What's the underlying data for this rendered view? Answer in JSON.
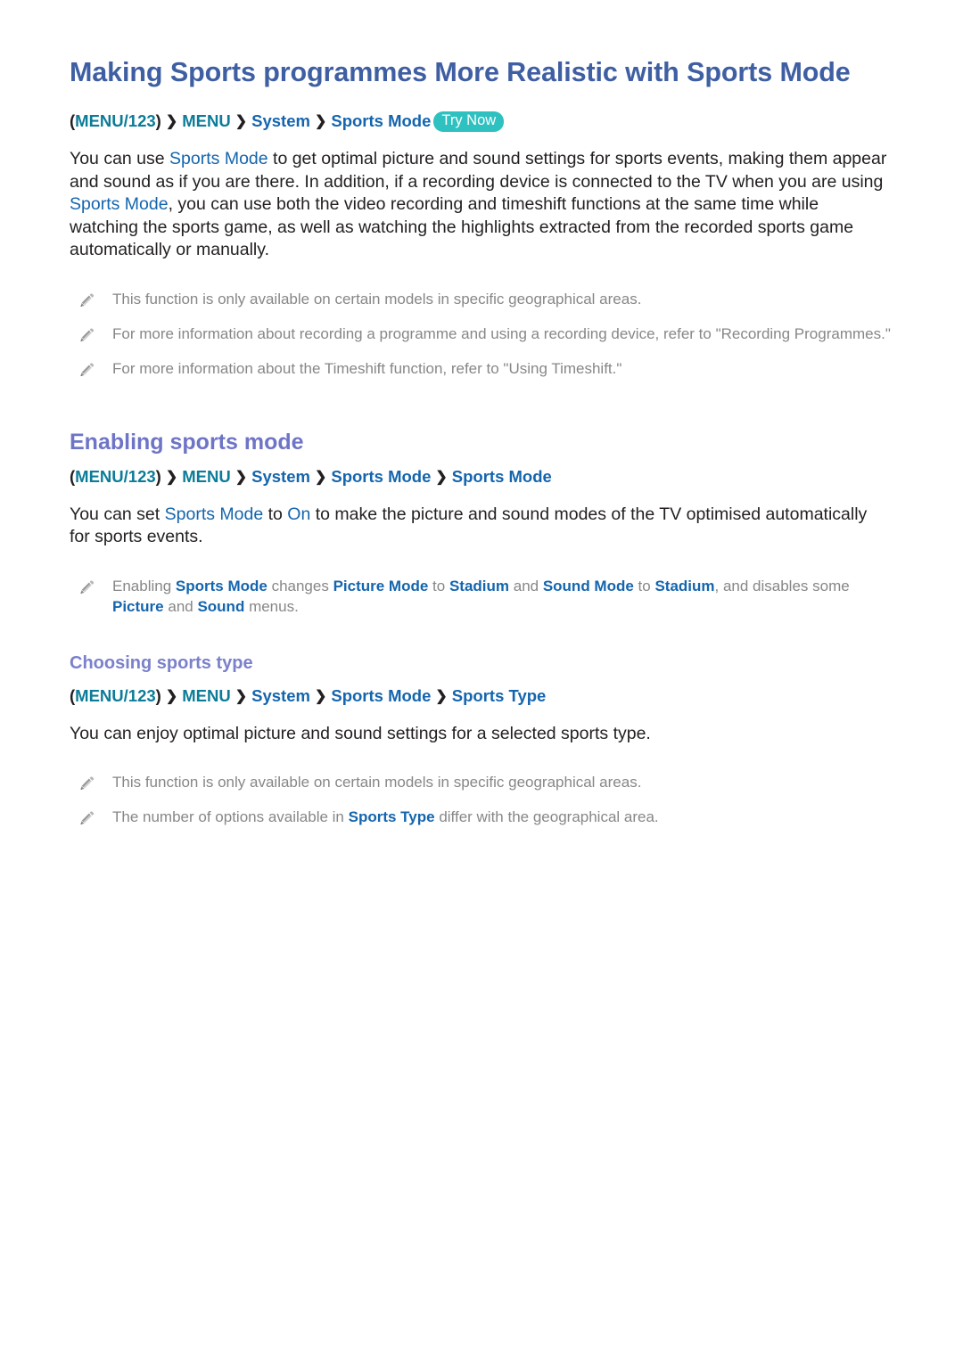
{
  "page": {
    "title": "Making Sports programmes More Realistic with Sports Mode"
  },
  "colors": {
    "title_blue": "#3f5fa3",
    "heading_purple": "#6e74c6",
    "subheading_purple": "#7b81ca",
    "link_blue": "#1465ae",
    "menu_teal": "#0c7c98",
    "badge_teal": "#2ec1bf",
    "note_gray": "#878787",
    "body_black": "#231f20",
    "background": "#ffffff"
  },
  "breadcrumb_main": {
    "open_paren": "(",
    "menu123": "MENU/123",
    "close_paren": ")",
    "separator": "❯",
    "items": [
      "MENU",
      "System",
      "Sports Mode"
    ],
    "badge": "Try Now"
  },
  "intro": {
    "p1_a": "You can use ",
    "p1_link1": "Sports Mode",
    "p1_b": " to get optimal picture and sound settings for sports events, making them appear and sound as if you are there. In addition, if a recording device is connected to the TV when you are using ",
    "p1_link2": "Sports Mode",
    "p1_c": ", you can use both the video recording and timeshift functions at the same time while watching the sports game, as well as watching the highlights extracted from the recorded sports game automatically or manually."
  },
  "intro_notes": [
    {
      "icon": "pencil-icon",
      "text": "This function is only available on certain models in specific geographical areas."
    },
    {
      "icon": "pencil-icon",
      "text": "For more information about recording a programme and using a recording device, refer to \"Recording Programmes.\""
    },
    {
      "icon": "pencil-icon",
      "text": "For more information about the Timeshift function, refer to \"Using Timeshift.\""
    }
  ],
  "section_enabling": {
    "heading": "Enabling sports mode",
    "breadcrumb": {
      "open_paren": "(",
      "menu123": "MENU/123",
      "close_paren": ")",
      "separator": "❯",
      "items": [
        "MENU",
        "System",
        "Sports Mode",
        "Sports Mode"
      ]
    },
    "body_a": "You can set ",
    "body_link1": "Sports Mode",
    "body_b": " to ",
    "body_link2": "On",
    "body_c": " to make the picture and sound modes of the TV optimised automatically for sports events.",
    "note": {
      "icon": "pencil-icon",
      "a": "Enabling ",
      "l1": "Sports Mode",
      "b": " changes ",
      "l2": "Picture Mode",
      "c": " to ",
      "l3": "Stadium",
      "d": " and ",
      "l4": "Sound Mode",
      "e": " to ",
      "l5": "Stadium",
      "f": ", and disables some ",
      "l6": "Picture",
      "g": " and ",
      "l7": "Sound",
      "h": " menus."
    }
  },
  "section_choosing": {
    "heading": "Choosing sports type",
    "breadcrumb": {
      "open_paren": "(",
      "menu123": "MENU/123",
      "close_paren": ")",
      "separator": "❯",
      "items": [
        "MENU",
        "System",
        "Sports Mode",
        "Sports Type"
      ]
    },
    "body": "You can enjoy optimal picture and sound settings for a selected sports type.",
    "notes": [
      {
        "icon": "pencil-icon",
        "text": "This function is only available on certain models in specific geographical areas."
      },
      {
        "icon": "pencil-icon",
        "a": "The number of options available in ",
        "l1": "Sports Type",
        "b": " differ with the geographical area."
      }
    ]
  }
}
